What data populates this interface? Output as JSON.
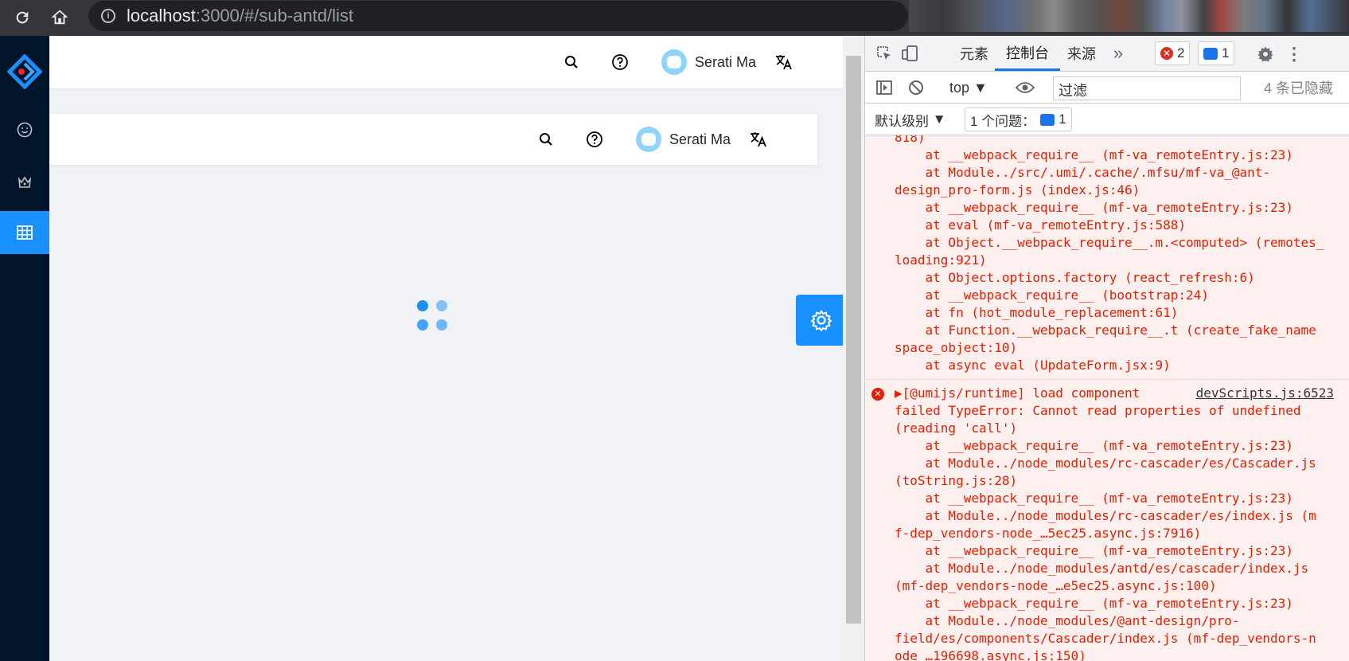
{
  "browser": {
    "url_host": "localhost",
    "url_path": ":3000/#/sub-antd/list"
  },
  "app": {
    "header_user": "Serati Ma",
    "header2_user": "Serati Ma"
  },
  "devtools": {
    "tabs": [
      "元素",
      "控制台",
      "来源"
    ],
    "active_tab": "控制台",
    "error_count": "2",
    "message_count": "1",
    "context": "top",
    "filter_placeholder": "过滤",
    "hidden_count": "4 条已隐藏",
    "level": "默认级别",
    "issues_label": "1 个问题：",
    "issues_count": "1"
  },
  "console": {
    "block1_lines": [
      "818)",
      "    at __webpack_require__ (mf-va_remoteEntry.js:23)",
      "    at Module../src/.umi/.cache/.mfsu/mf-va_@ant-",
      "design_pro-form.js (index.js:46)",
      "    at __webpack_require__ (mf-va_remoteEntry.js:23)",
      "    at eval (mf-va_remoteEntry.js:588)",
      "    at Object.__webpack_require__.m.<computed> (remotes_",
      "loading:921)",
      "    at Object.options.factory (react_refresh:6)",
      "    at __webpack_require__ (bootstrap:24)",
      "    at fn (hot_module_replacement:61)",
      "    at Function.__webpack_require__.t (create_fake_name",
      "space_object:10)",
      "    at async eval (UpdateForm.jsx:9)"
    ],
    "block2_source": "devScripts.js:6523",
    "block2_lines": [
      "▶[@umijs/runtime] load component",
      "failed TypeError: Cannot read properties of undefined",
      "(reading 'call')",
      "    at __webpack_require__ (mf-va_remoteEntry.js:23)",
      "    at Module../node_modules/rc-cascader/es/Cascader.js",
      "(toString.js:28)",
      "    at __webpack_require__ (mf-va_remoteEntry.js:23)",
      "    at Module../node_modules/rc-cascader/es/index.js (m",
      "f-dep_vendors-node_…5ec25.async.js:7916)",
      "    at __webpack_require__ (mf-va_remoteEntry.js:23)",
      "    at Module../node_modules/antd/es/cascader/index.js",
      "(mf-dep_vendors-node_…e5ec25.async.js:100)",
      "    at __webpack_require__ (mf-va_remoteEntry.js:23)",
      "    at Module../node_modules/@ant-design/pro-",
      "field/es/components/Cascader/index.js (mf-dep_vendors-n",
      "ode_…196698.async.js:150)"
    ]
  }
}
